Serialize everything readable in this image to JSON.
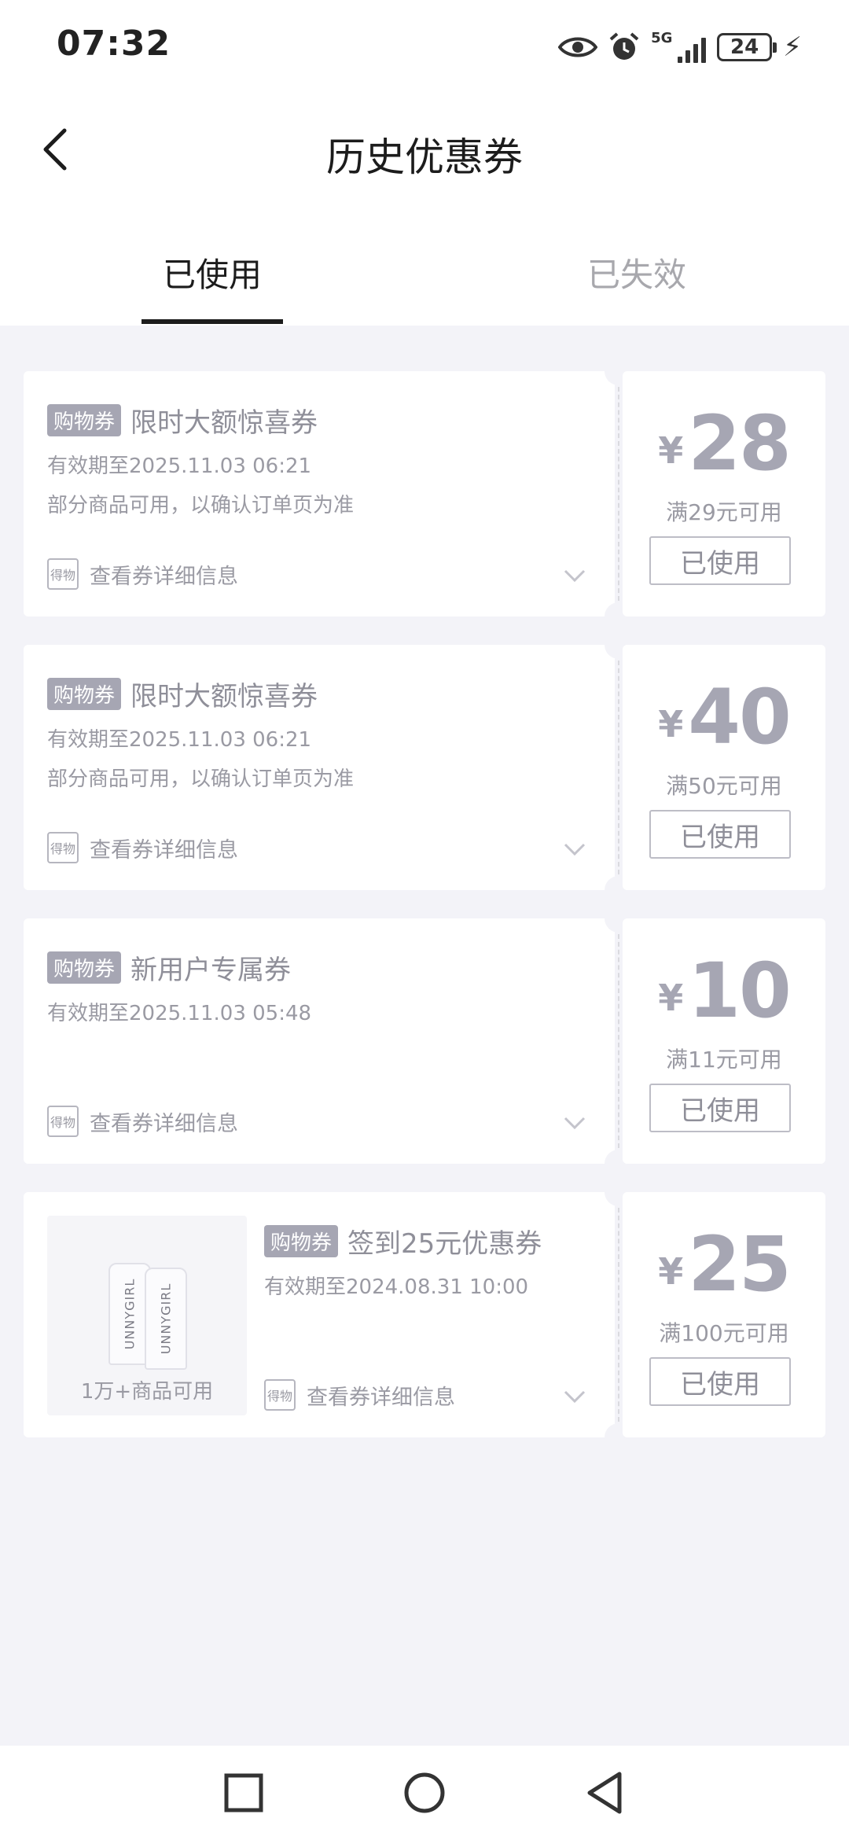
{
  "status_bar": {
    "time": "07:32",
    "network": "5G",
    "battery": "24",
    "icons": [
      "eye-icon",
      "alarm-icon",
      "signal-icon",
      "battery-icon",
      "charging-icon"
    ]
  },
  "header": {
    "title": "历史优惠券",
    "back_icon": "back-arrow-icon"
  },
  "tabs": [
    {
      "label": "已使用",
      "active": true
    },
    {
      "label": "已失效",
      "active": false
    }
  ],
  "coupons": [
    {
      "tag": "购物券",
      "title": "限时大额惊喜券",
      "validity": "有效期至2025.11.03 06:21",
      "scope": "部分商品可用，以确认订单页为准",
      "detail_label": "查看券详细信息",
      "detail_icon_text": "得物",
      "currency": "¥",
      "amount": "28",
      "threshold": "满29元可用",
      "status": "已使用"
    },
    {
      "tag": "购物券",
      "title": "限时大额惊喜券",
      "validity": "有效期至2025.11.03 06:21",
      "scope": "部分商品可用，以确认订单页为准",
      "detail_label": "查看券详细信息",
      "detail_icon_text": "得物",
      "currency": "¥",
      "amount": "40",
      "threshold": "满50元可用",
      "status": "已使用"
    },
    {
      "tag": "购物券",
      "title": "新用户专属券",
      "validity": "有效期至2025.11.03 05:48",
      "detail_label": "查看券详细信息",
      "detail_icon_text": "得物",
      "currency": "¥",
      "amount": "10",
      "threshold": "满11元可用",
      "status": "已使用"
    },
    {
      "tag": "购物券",
      "title": "签到25元优惠券",
      "validity": "有效期至2024.08.31 10:00",
      "detail_label": "查看券详细信息",
      "detail_icon_text": "得物",
      "product_label": "1万+商品可用",
      "product_brand": "UNNYGIRL",
      "currency": "¥",
      "amount": "25",
      "threshold": "满100元可用",
      "status": "已使用"
    }
  ],
  "nav_bar": {
    "icons": [
      "recent-apps-icon",
      "home-icon",
      "back-icon"
    ]
  }
}
